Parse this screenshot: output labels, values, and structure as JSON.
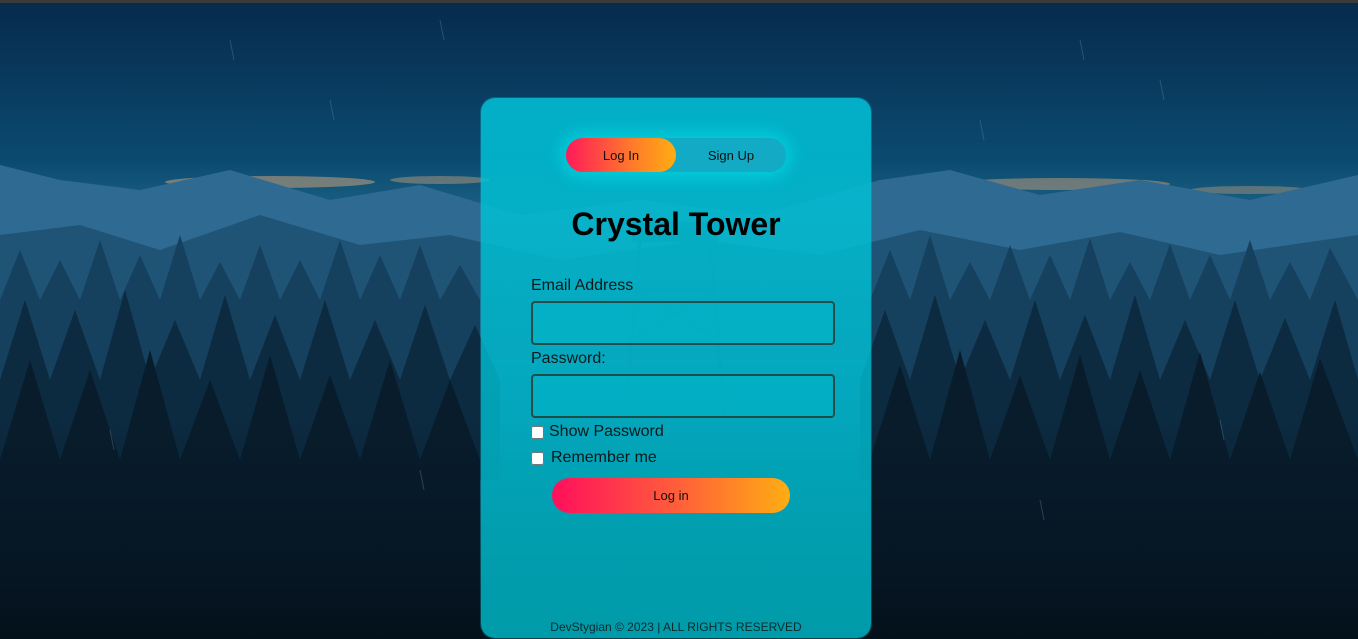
{
  "toggle": {
    "login_label": "Log In",
    "signup_label": "Sign Up"
  },
  "form": {
    "title": "Crystal Tower",
    "email_label": "Email Address",
    "email_value": "",
    "password_label": "Password:",
    "password_value": "",
    "show_password_label": "Show Password",
    "show_password_checked": false,
    "remember_label": "Remember me",
    "remember_checked": false,
    "submit_label": "Log in"
  },
  "footer": {
    "text": "DevStygian © 2023 | ALL RIGHTS RESERVED"
  },
  "colors": {
    "card": "#00bcd0",
    "accent_start": "#ff1a5a",
    "accent_end": "#ffad12",
    "sky_top": "#0a2a4a",
    "forest_dark": "#061520"
  }
}
